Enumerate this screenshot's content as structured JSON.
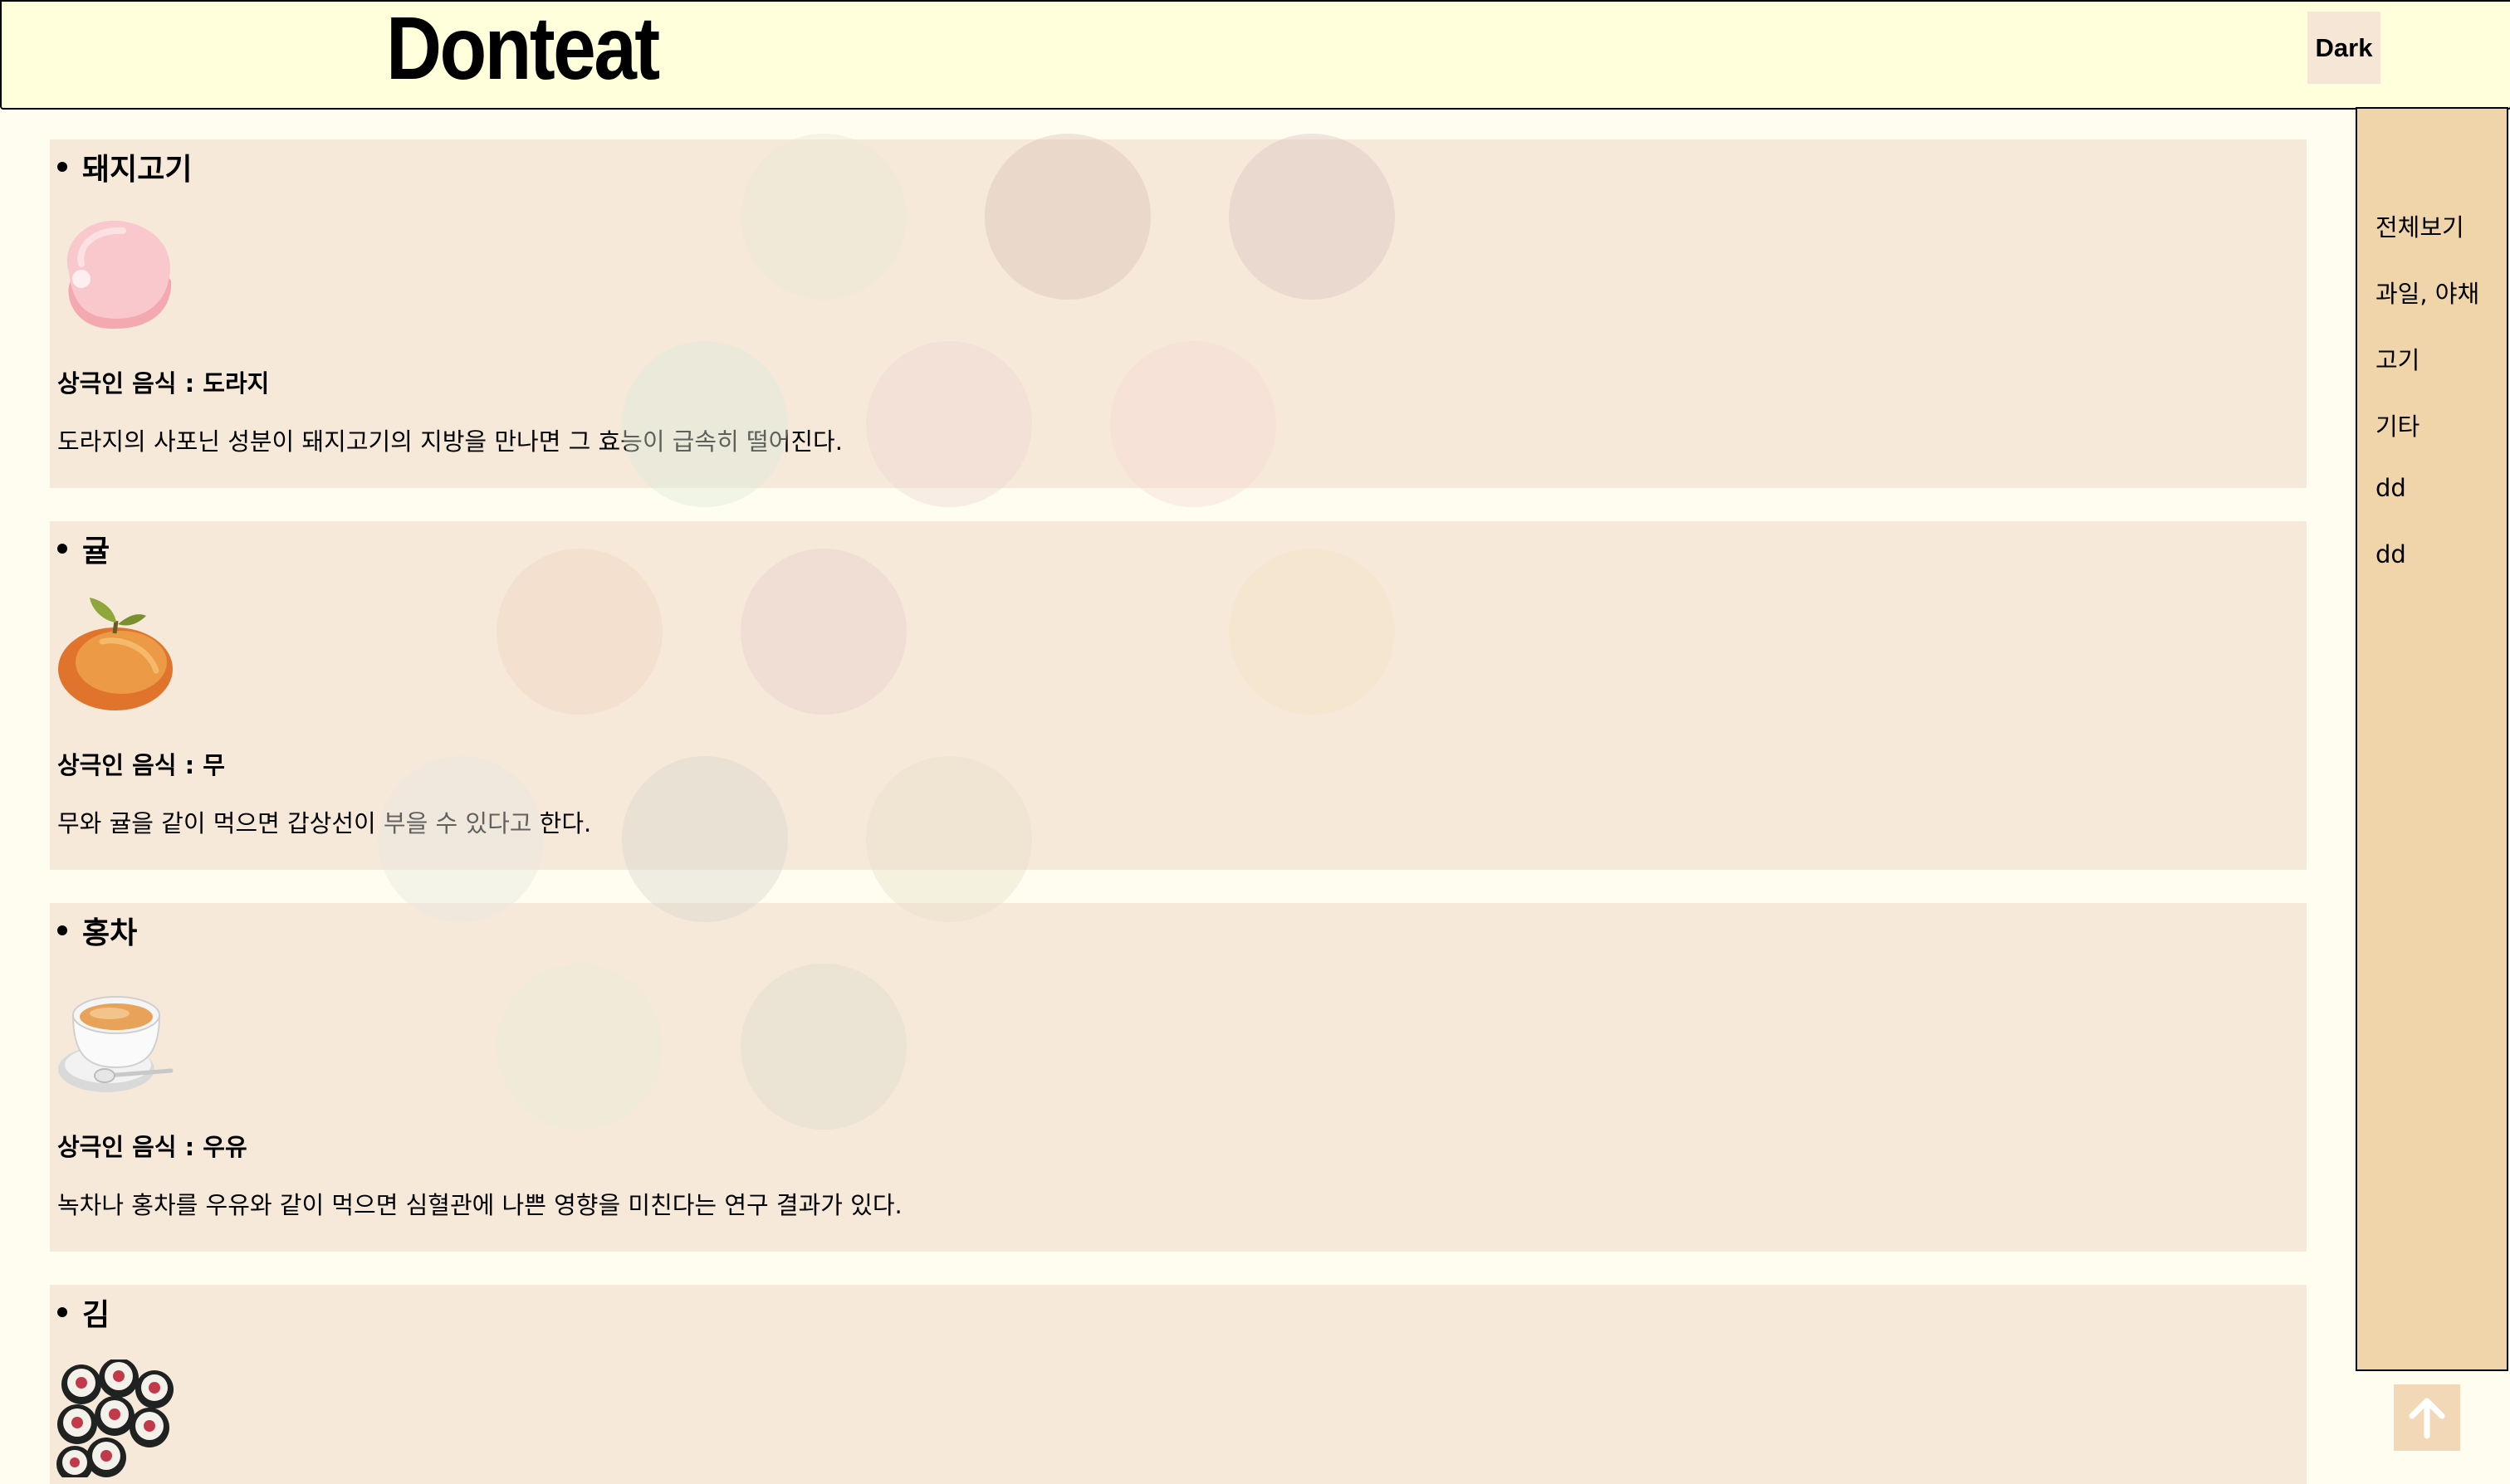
{
  "header": {
    "logo": "Donteat",
    "theme_button": "Dark"
  },
  "items": [
    {
      "name": "돼지고기",
      "icon": "ham-icon",
      "conflict": "상극인 음식 : 도라지",
      "description": "도라지의 사포닌 성분이 돼지고기의 지방을 만나면 그 효능이 급속히 떨어진다."
    },
    {
      "name": "귤",
      "icon": "tangerine-icon",
      "conflict": "상극인 음식 : 무",
      "description": "무와 귤을 같이 먹으면 갑상선이 부을 수 있다고 한다."
    },
    {
      "name": "홍차",
      "icon": "tea-cup-icon",
      "conflict": "상극인 음식 : 우유",
      "description": "녹차나 홍차를 우유와 같이 먹으면 심혈관에 나쁜 영향을 미친다는 연구 결과가 있다."
    },
    {
      "name": "김",
      "icon": "gimbap-icon"
    }
  ],
  "sidebar": {
    "items": [
      {
        "label": "전체보기"
      },
      {
        "label": "과일, 야채"
      },
      {
        "label": "고기"
      },
      {
        "label": "기타"
      },
      {
        "label": "dd"
      },
      {
        "label": "dd"
      }
    ]
  },
  "scroll_top": {
    "icon": "arrow-up-icon"
  },
  "colors": {
    "page_bg": "#fffdf0",
    "header_bg": "#ffffdc",
    "card_bg": "#f7e9d9",
    "sidebar_bg": "#efd5a9",
    "button_bg": "#f6e6d6"
  }
}
